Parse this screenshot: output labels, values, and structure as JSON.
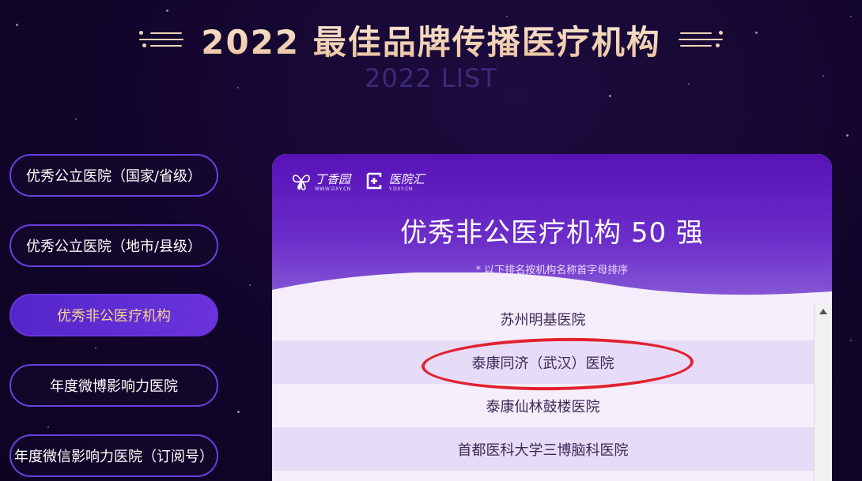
{
  "header": {
    "title": "2022 最佳品牌传播医疗机构",
    "subtitle": "2022 LIST"
  },
  "sidebar": {
    "items": [
      {
        "label": "优秀公立医院（国家/省级）",
        "active": false
      },
      {
        "label": "优秀公立医院（地市/县级）",
        "active": false
      },
      {
        "label": "优秀非公医疗机构",
        "active": true
      },
      {
        "label": "年度微博影响力医院",
        "active": false
      },
      {
        "label": "年度微信影响力医院（订阅号）",
        "active": false
      }
    ]
  },
  "panel": {
    "logos": [
      {
        "name": "丁香园",
        "sub": "WWW.DXY.CN",
        "icon": "dxy-flower-icon"
      },
      {
        "name": "医院汇",
        "sub": "Y.DXY.CN",
        "icon": "yiyuanhui-icon"
      }
    ],
    "title": "优秀非公医疗机构 50 强",
    "note": "* 以下排名按机构名称首字母排序",
    "rows": [
      "苏州明基医院",
      "泰康同济（武汉）医院",
      "泰康仙林鼓楼医院",
      "首都医科大学三博脑科医院"
    ]
  },
  "colors": {
    "accent": "#6a33dc",
    "active_text": "#f6d38f",
    "title_gold": "#f2d3b6",
    "highlight": "#e2222f"
  }
}
